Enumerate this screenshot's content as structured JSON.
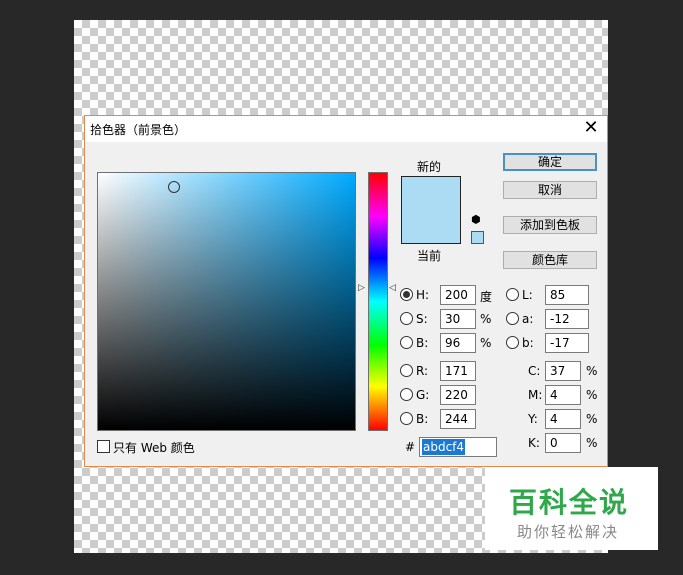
{
  "dialog": {
    "title": "拾色器（前景色）",
    "close_symbol": "✕"
  },
  "preview": {
    "new_label": "新的",
    "current_label": "当前",
    "new_color": "#abdcf4",
    "current_color": "#abdcf4"
  },
  "buttons": {
    "ok": "确定",
    "cancel": "取消",
    "add_to_swatches": "添加到色板",
    "color_libraries": "颜色库"
  },
  "hsb": {
    "h": {
      "label": "H:",
      "value": "200",
      "unit": "度",
      "checked": true
    },
    "s": {
      "label": "S:",
      "value": "30",
      "unit": "%"
    },
    "b": {
      "label": "B:",
      "value": "96",
      "unit": "%"
    }
  },
  "rgb": {
    "r": {
      "label": "R:",
      "value": "171"
    },
    "g": {
      "label": "G:",
      "value": "220"
    },
    "b": {
      "label": "B:",
      "value": "244"
    }
  },
  "lab": {
    "l": {
      "label": "L:",
      "value": "85"
    },
    "a": {
      "label": "a:",
      "value": "-12"
    },
    "b": {
      "label": "b:",
      "value": "-17"
    }
  },
  "cmyk": {
    "c": {
      "label": "C:",
      "value": "37",
      "unit": "%"
    },
    "m": {
      "label": "M:",
      "value": "4",
      "unit": "%"
    },
    "y": {
      "label": "Y:",
      "value": "4",
      "unit": "%"
    },
    "k": {
      "label": "K:",
      "value": "0",
      "unit": "%"
    }
  },
  "web_only": {
    "label": "只有 Web 颜色",
    "checked": false
  },
  "hex": {
    "hash": "#",
    "value": "abdcf4"
  },
  "watermark": {
    "title": "百科全说",
    "subtitle": "助你轻松解决"
  },
  "icons": {
    "cube": "cube-icon",
    "close": "close-icon"
  }
}
